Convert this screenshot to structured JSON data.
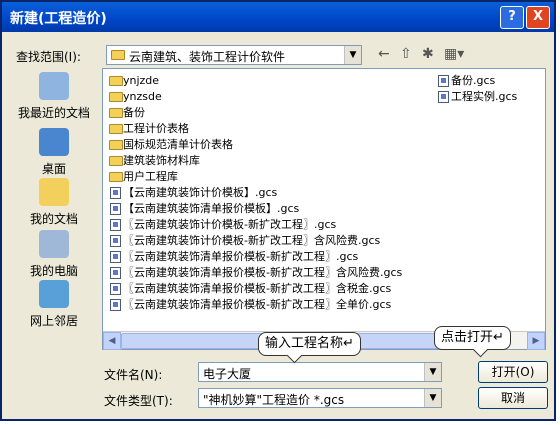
{
  "title": "新建(工程造价)",
  "title_buttons": {
    "help": "?",
    "close": "X"
  },
  "lookin": {
    "label": "查找范围(I):",
    "value": "云南建筑、装饰工程计价软件"
  },
  "places": [
    {
      "name": "recent",
      "label": "我最近的文档",
      "icon": "recent-docs-icon"
    },
    {
      "name": "desktop",
      "label": "桌面",
      "icon": "desktop-icon"
    },
    {
      "name": "mydocs",
      "label": "我的文档",
      "icon": "my-documents-icon"
    },
    {
      "name": "mycomputer",
      "label": "我的电脑",
      "icon": "my-computer-icon"
    },
    {
      "name": "network",
      "label": "网上邻居",
      "icon": "network-places-icon"
    }
  ],
  "files_col1": [
    {
      "type": "folder",
      "name": "ynjzde"
    },
    {
      "type": "folder",
      "name": "ynzsde"
    },
    {
      "type": "folder",
      "name": "备份"
    },
    {
      "type": "folder",
      "name": "工程计价表格"
    },
    {
      "type": "folder",
      "name": "国标规范清单计价表格"
    },
    {
      "type": "folder",
      "name": "建筑装饰材料库"
    },
    {
      "type": "folder",
      "name": "用户工程库"
    },
    {
      "type": "file",
      "name": "【云南建筑装饰计价模板】.gcs"
    },
    {
      "type": "file",
      "name": "【云南建筑装饰清单报价模板】.gcs"
    },
    {
      "type": "file",
      "name": "〖云南建筑装饰计价模板-新扩改工程〗.gcs"
    },
    {
      "type": "file",
      "name": "〖云南建筑装饰计价模板-新扩改工程〗含风险费.gcs"
    },
    {
      "type": "file",
      "name": "〖云南建筑装饰清单报价模板-新扩改工程〗.gcs"
    },
    {
      "type": "file",
      "name": "〖云南建筑装饰清单报价模板-新扩改工程〗含风险费.gcs"
    },
    {
      "type": "file",
      "name": "〖云南建筑装饰清单报价模板-新扩改工程〗含税金.gcs"
    },
    {
      "type": "file",
      "name": "〖云南建筑装饰清单报价模板-新扩改工程〗全单价.gcs"
    }
  ],
  "files_col2": [
    {
      "type": "file",
      "name": "备份.gcs"
    },
    {
      "type": "file",
      "name": "工程实例.gcs"
    }
  ],
  "filename": {
    "label": "文件名(N):",
    "value": "电子大厦"
  },
  "filetype": {
    "label": "文件类型(T):",
    "value": "\"神机妙算\"工程造价 *.gcs"
  },
  "buttons": {
    "open": "打开(O)",
    "cancel": "取消"
  },
  "callouts": {
    "name_hint": "输入工程名称↵",
    "open_hint": "点击打开↵"
  },
  "toolbar_icons": [
    "back-arrow-icon",
    "up-folder-icon",
    "new-folder-icon",
    "view-menu-icon"
  ]
}
